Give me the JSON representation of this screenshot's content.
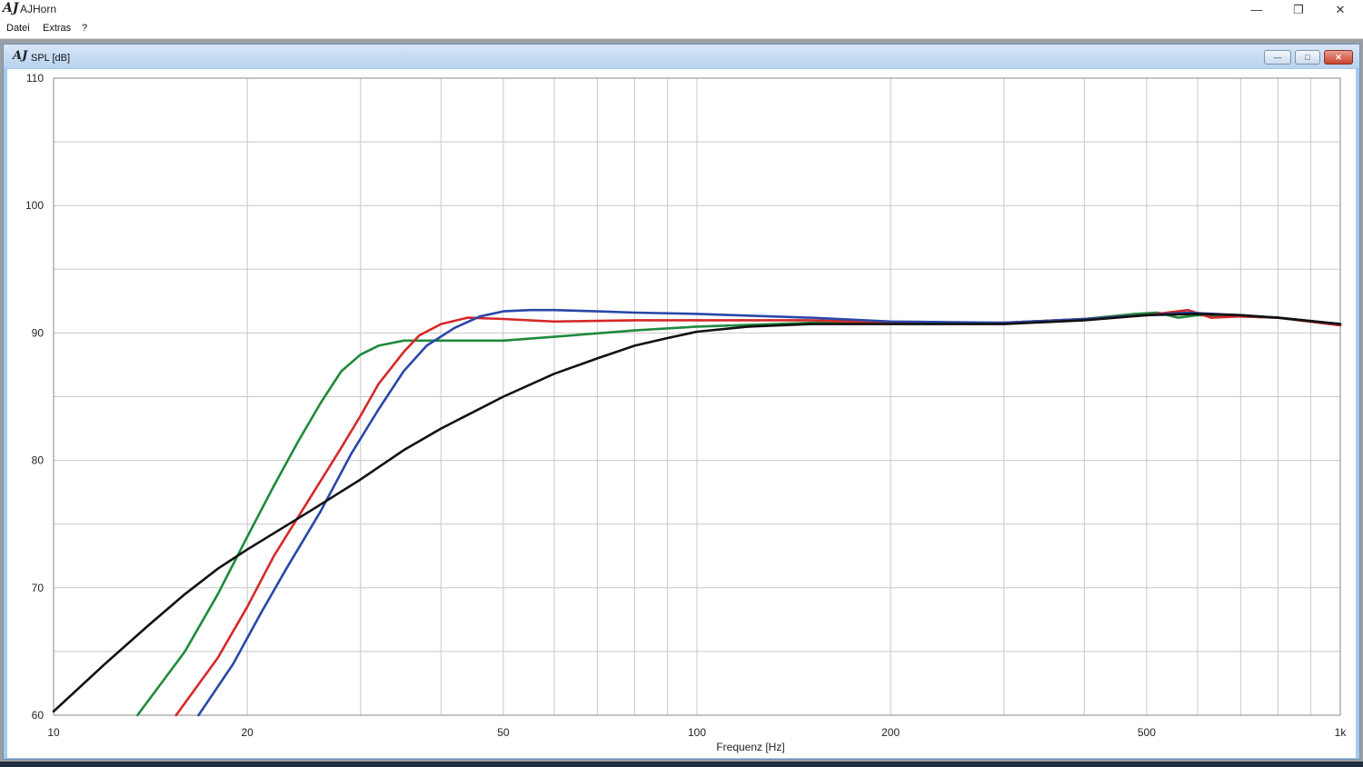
{
  "window": {
    "app_logo": "AJ",
    "title": "AJHorn",
    "minimize_glyph": "—",
    "restore_glyph": "❐",
    "close_glyph": "✕"
  },
  "menu": {
    "items": [
      "Datei",
      "Extras",
      "?"
    ]
  },
  "child_window": {
    "logo": "AJ",
    "title": "SPL [dB]",
    "minimize_glyph": "—",
    "restore_glyph": "□",
    "close_glyph": "✕"
  },
  "chart_data": {
    "type": "line",
    "title": "",
    "xlabel": "Frequenz [Hz]",
    "ylabel": "",
    "x_scale": "log",
    "xlim": [
      10,
      1000
    ],
    "ylim": [
      60,
      110
    ],
    "x_ticks": [
      {
        "value": 10,
        "label": "10"
      },
      {
        "value": 20,
        "label": "20"
      },
      {
        "value": 50,
        "label": "50"
      },
      {
        "value": 100,
        "label": "100"
      },
      {
        "value": 200,
        "label": "200"
      },
      {
        "value": 500,
        "label": "500"
      },
      {
        "value": 1000,
        "label": "1k"
      }
    ],
    "y_ticks": [
      60,
      70,
      80,
      90,
      100,
      110
    ],
    "grid": true,
    "series": [
      {
        "color": "#1f8a3c",
        "points": [
          [
            13.5,
            60
          ],
          [
            16,
            65
          ],
          [
            18,
            69.5
          ],
          [
            20,
            74
          ],
          [
            22,
            78
          ],
          [
            24,
            81.5
          ],
          [
            26,
            84.5
          ],
          [
            28,
            87
          ],
          [
            30,
            88.3
          ],
          [
            32,
            89
          ],
          [
            35,
            89.4
          ],
          [
            40,
            89.4
          ],
          [
            50,
            89.4
          ],
          [
            60,
            89.7
          ],
          [
            80,
            90.2
          ],
          [
            100,
            90.5
          ],
          [
            150,
            90.8
          ],
          [
            200,
            90.8
          ],
          [
            300,
            90.8
          ],
          [
            400,
            91.1
          ],
          [
            480,
            91.5
          ],
          [
            520,
            91.6
          ],
          [
            560,
            91.2
          ],
          [
            600,
            91.4
          ],
          [
            700,
            91.3
          ],
          [
            800,
            91.2
          ],
          [
            1000,
            90.6
          ]
        ]
      },
      {
        "color": "#d62828",
        "points": [
          [
            15.5,
            60
          ],
          [
            18,
            64.5
          ],
          [
            20,
            68.5
          ],
          [
            22,
            72.5
          ],
          [
            25,
            77
          ],
          [
            28,
            81
          ],
          [
            30,
            83.5
          ],
          [
            32,
            86
          ],
          [
            35,
            88.5
          ],
          [
            37,
            89.8
          ],
          [
            40,
            90.7
          ],
          [
            44,
            91.2
          ],
          [
            50,
            91.1
          ],
          [
            60,
            90.9
          ],
          [
            80,
            91
          ],
          [
            100,
            91
          ],
          [
            150,
            91
          ],
          [
            200,
            90.8
          ],
          [
            300,
            90.8
          ],
          [
            400,
            91.1
          ],
          [
            500,
            91.4
          ],
          [
            580,
            91.8
          ],
          [
            630,
            91.2
          ],
          [
            700,
            91.3
          ],
          [
            800,
            91.2
          ],
          [
            1000,
            90.6
          ]
        ]
      },
      {
        "color": "#2a47a8",
        "points": [
          [
            16.8,
            60
          ],
          [
            19,
            64
          ],
          [
            21,
            68
          ],
          [
            23,
            71.5
          ],
          [
            26,
            76
          ],
          [
            29,
            80.5
          ],
          [
            32,
            84
          ],
          [
            35,
            87
          ],
          [
            38,
            89
          ],
          [
            42,
            90.4
          ],
          [
            46,
            91.3
          ],
          [
            50,
            91.7
          ],
          [
            55,
            91.8
          ],
          [
            60,
            91.8
          ],
          [
            70,
            91.7
          ],
          [
            80,
            91.6
          ],
          [
            100,
            91.5
          ],
          [
            150,
            91.2
          ],
          [
            200,
            90.9
          ],
          [
            300,
            90.8
          ],
          [
            400,
            91.1
          ],
          [
            500,
            91.4
          ],
          [
            580,
            91.6
          ],
          [
            700,
            91.4
          ],
          [
            800,
            91.2
          ],
          [
            1000,
            90.7
          ]
        ]
      },
      {
        "color": "#111111",
        "points": [
          [
            10,
            60.3
          ],
          [
            12,
            64
          ],
          [
            14,
            67
          ],
          [
            16,
            69.5
          ],
          [
            18,
            71.5
          ],
          [
            20,
            73
          ],
          [
            25,
            76
          ],
          [
            30,
            78.5
          ],
          [
            35,
            80.8
          ],
          [
            40,
            82.5
          ],
          [
            50,
            85
          ],
          [
            60,
            86.8
          ],
          [
            70,
            88
          ],
          [
            80,
            89
          ],
          [
            90,
            89.6
          ],
          [
            100,
            90.1
          ],
          [
            120,
            90.5
          ],
          [
            150,
            90.7
          ],
          [
            200,
            90.7
          ],
          [
            300,
            90.7
          ],
          [
            400,
            91
          ],
          [
            500,
            91.4
          ],
          [
            600,
            91.5
          ],
          [
            700,
            91.4
          ],
          [
            800,
            91.2
          ],
          [
            1000,
            90.7
          ]
        ]
      }
    ]
  }
}
